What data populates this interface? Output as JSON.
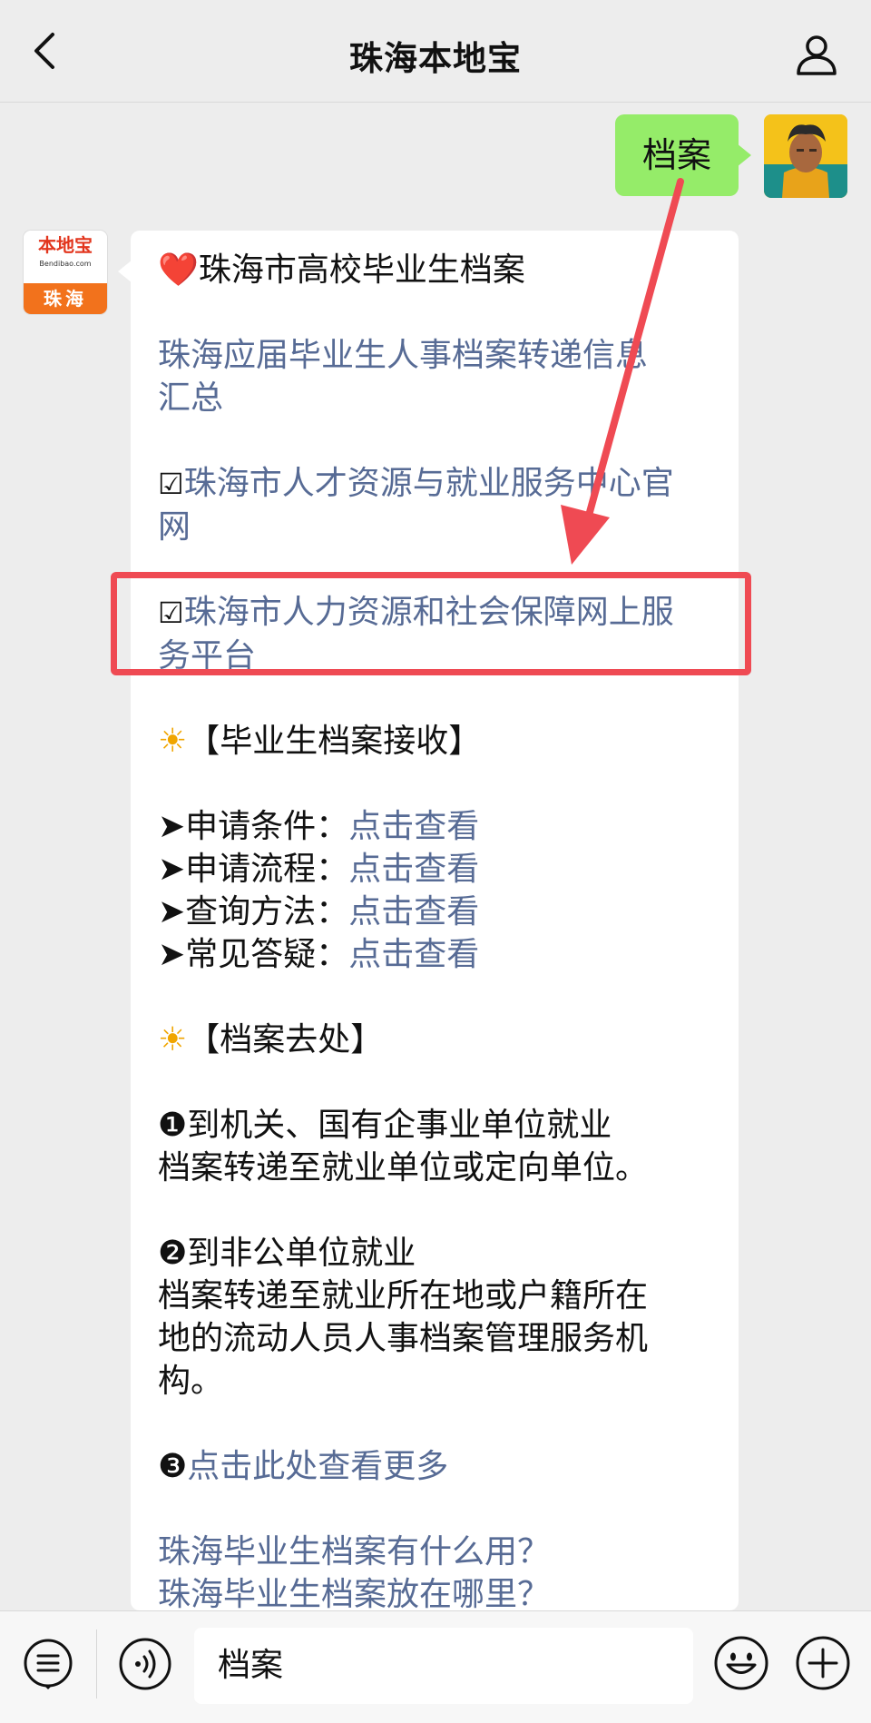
{
  "header": {
    "title": "珠海本地宝"
  },
  "user_message": {
    "text": "档案"
  },
  "bot_avatar": {
    "logo_text": "本地宝",
    "logo_domain": "Bendibao.com",
    "city": "珠海"
  },
  "bot_message": {
    "title_emoji": "❤️",
    "title": "珠海市高校毕业生档案",
    "link1_line1": "珠海应届毕业生人事档案转递信息",
    "link1_line2": "汇总",
    "checkbox": "☑",
    "link2_line1": "珠海市人才资源与就业服务中心官",
    "link2_line2": "网",
    "link3_line1": "珠海市人力资源和社会保障网上服",
    "link3_line2": "务平台",
    "sun_emoji": "☀",
    "section1": "【毕业生档案接收】",
    "arrow": "➤",
    "items": [
      {
        "label": "申请条件：",
        "link": "点击查看"
      },
      {
        "label": "申请流程：",
        "link": "点击查看"
      },
      {
        "label": "查询方法：",
        "link": "点击查看"
      },
      {
        "label": "常见答疑：",
        "link": "点击查看"
      }
    ],
    "section2": "【档案去处】",
    "p1_num": "❶",
    "p1_title": "到机关、国有企事业单位就业",
    "p1_body": "档案转递至就业单位或定向单位。",
    "p2_num": "❷",
    "p2_title": "到非公单位就业",
    "p2_body_line1": "档案转递至就业所在地或户籍所在",
    "p2_body_line2": "地的流动人员人事档案管理服务机",
    "p2_body_line3": "构。",
    "p3_num": "❸",
    "p3_link": "点击此处查看更多",
    "faq1": "珠海毕业生档案有什么用？",
    "faq2": "珠海毕业生档案放在哪里？"
  },
  "input_bar": {
    "value": "档案"
  },
  "colors": {
    "background": "#ededed",
    "user_bubble": "#95ec69",
    "link": "#576b95",
    "highlight": "#ef4a53",
    "brand_orange": "#f2721c"
  }
}
